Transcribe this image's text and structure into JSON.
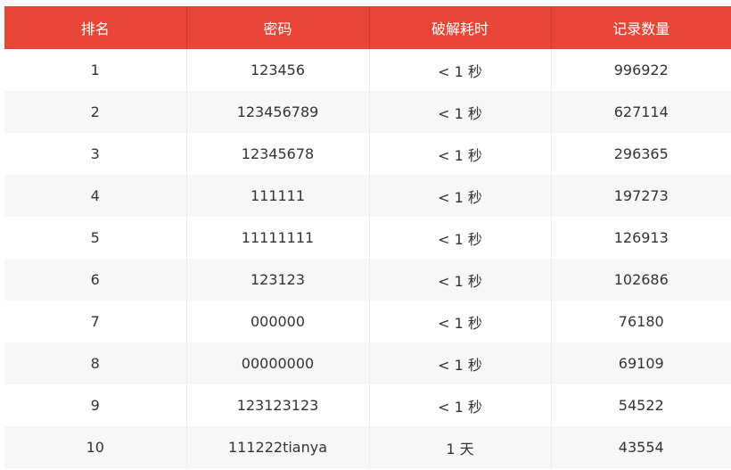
{
  "table": {
    "headers": [
      "排名",
      "密码",
      "破解耗时",
      "记录数量"
    ],
    "rows": [
      [
        "1",
        "123456",
        "< 1 秒",
        "996922"
      ],
      [
        "2",
        "123456789",
        "< 1 秒",
        "627114"
      ],
      [
        "3",
        "12345678",
        "< 1 秒",
        "296365"
      ],
      [
        "4",
        "111111",
        "< 1 秒",
        "197273"
      ],
      [
        "5",
        "11111111",
        "< 1 秒",
        "126913"
      ],
      [
        "6",
        "123123",
        "< 1 秒",
        "102686"
      ],
      [
        "7",
        "000000",
        "< 1 秒",
        "76180"
      ],
      [
        "8",
        "00000000",
        "< 1 秒",
        "69109"
      ],
      [
        "9",
        "123123123",
        "< 1 秒",
        "54522"
      ],
      [
        "10",
        "111222tianya",
        "1 天",
        "43554"
      ]
    ]
  },
  "colors": {
    "header_bg": "#e74536",
    "header_text": "#ffffff",
    "row_alt_bg": "#f7f7f7",
    "cell_text": "#333333"
  }
}
